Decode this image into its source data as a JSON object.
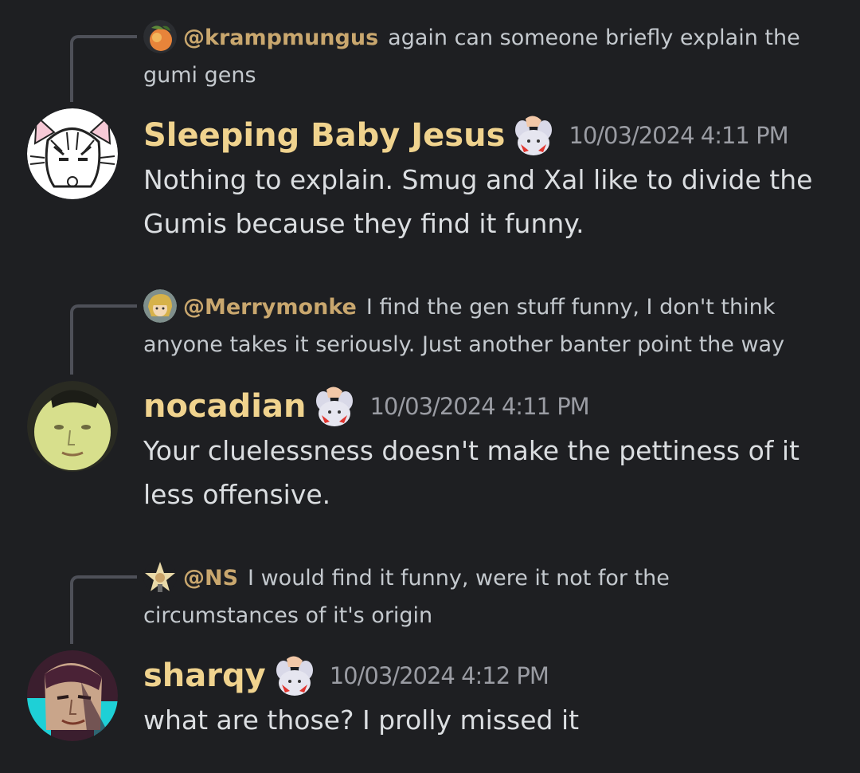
{
  "colors": {
    "background": "#1e1f22",
    "username": "#f0d38e",
    "reply_author": "#c9a76e",
    "text": "#dbdee1",
    "reply_text": "#c4c9ce",
    "timestamp": "#9a9ca3",
    "spine": "#4e5058"
  },
  "messages": [
    {
      "reply": {
        "author": "@krampmungus",
        "text": "again can someone briefly explain the gumi gens",
        "avatar_icon": "peach-avatar-icon"
      },
      "author": "Sleeping Baby Jesus",
      "avatar_icon": "cat-girl-avatar",
      "badge_icon": "rabbit-hand-emoji-icon",
      "timestamp": "10/03/2024 4:11 PM",
      "text": "Nothing to explain. Smug and Xal like to divide the Gumis because they find it funny."
    },
    {
      "reply": {
        "author": "@Merrymonke",
        "text": "I find the gen stuff funny, I don't think anyone takes it seriously. Just another banter point the way",
        "avatar_icon": "anime-girl-avatar-icon"
      },
      "author": "nocadian",
      "avatar_icon": "yellow-face-avatar",
      "badge_icon": "rabbit-hand-emoji-icon",
      "timestamp": "10/03/2024 4:11 PM",
      "text": "Your cluelessness doesn't make the pettiness of it less offensive."
    },
    {
      "reply": {
        "author": "@NS",
        "text": "I would find it funny, were it not for the circumstances of it's origin",
        "avatar_icon": "star-avatar-icon"
      },
      "author": "sharqy",
      "avatar_icon": "anime-man-avatar",
      "badge_icon": "rabbit-hand-emoji-icon",
      "timestamp": "10/03/2024 4:12 PM",
      "text": "what are those? I prolly missed it"
    }
  ]
}
